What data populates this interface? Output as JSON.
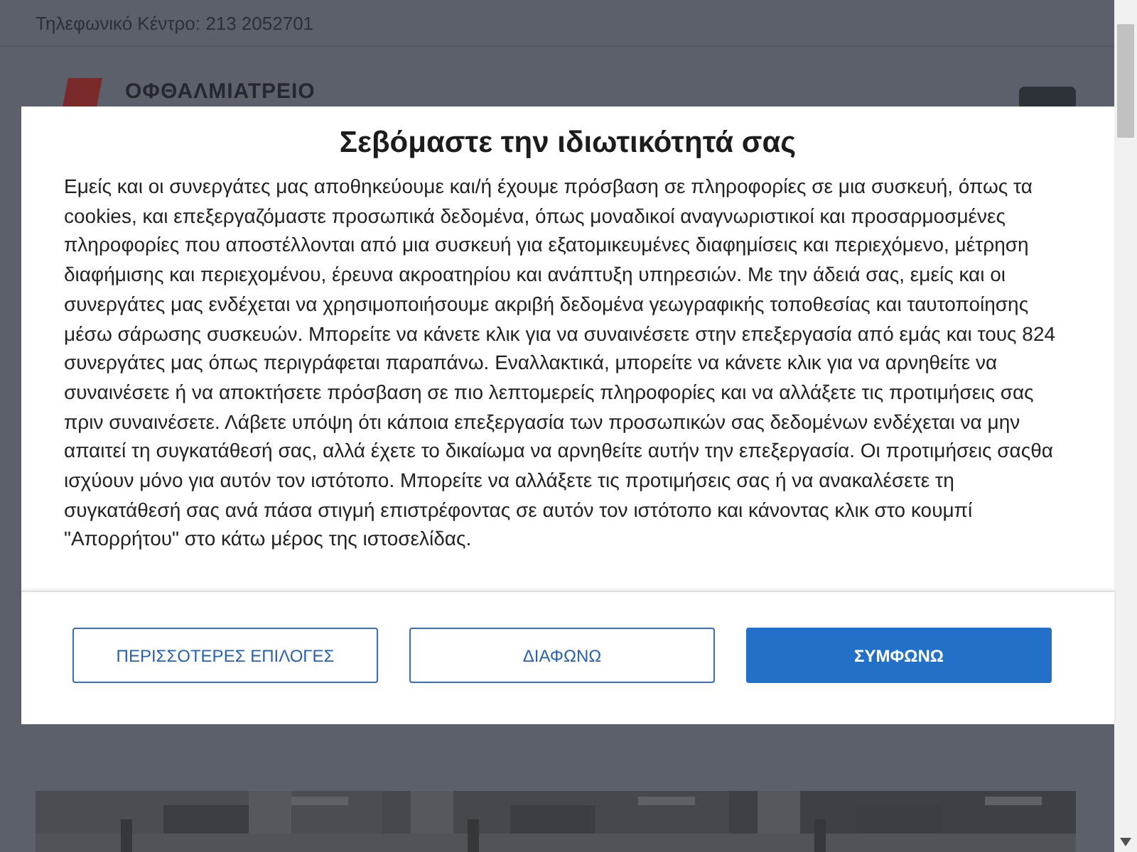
{
  "top_bar": {
    "phone": "Τηλεφωνικό Κέντρο: 213 2052701"
  },
  "header": {
    "logo_text": "ΟΦΘΑΛΜΙΑΤΡΕΙΟ"
  },
  "consent_dialog": {
    "title": "Σεβόμαστε την ιδιωτικότητά σας",
    "body": "Εμείς και οι συνεργάτες μας αποθηκεύουμε και/ή έχουμε πρόσβαση σε πληροφορίες σε μια συσκευή, όπως τα cookies, και επεξεργαζόμαστε προσωπικά δεδομένα, όπως μοναδικοί αναγνωριστικοί και προσαρμοσμένες πληροφορίες που αποστέλλονται από μια συσκευή για εξατομικευμένες διαφημίσεις και περιεχόμενο, μέτρηση διαφήμισης και περιεχομένου, έρευνα ακροατηρίου και ανάπτυξη υπηρεσιών. Με την άδειά σας, εμείς και οι συνεργάτες μας ενδέχεται να χρησιμοποιήσουμε ακριβή δεδομένα γεωγραφικής τοποθεσίας και ταυτοποίησης μέσω σάρωσης συσκευών. Μπορείτε να κάνετε κλικ για να συναινέσετε στην επεξεργασία από εμάς και τους 824 συνεργάτες μας όπως περιγράφεται παραπάνω. Εναλλακτικά, μπορείτε να κάνετε κλικ για να αρνηθείτε να συναινέσετε ή να αποκτήσετε πρόσβαση σε πιο λεπτομερείς πληροφορίες και να αλλάξετε τις προτιμήσεις σας πριν συναινέσετε. Λάβετε υπόψη ότι κάποια επεξεργασία των προσωπικών σας δεδομένων ενδέχεται να μην απαιτεί τη συγκατάθεσή σας, αλλά έχετε το δικαίωμα να αρνηθείτε αυτήν την επεξεργασία. Οι προτιμήσεις σαςθα ισχύουν μόνο για αυτόν τον ιστότοπο. Μπορείτε να αλλάξετε τις προτιμήσεις σας ή να ανακαλέσετε τη συγκατάθεσή σας ανά πάσα στιγμή επιστρέφοντας σε αυτόν τον ιστότοπο και κάνοντας κλικ στο κουμπί \"Απορρήτου\" στο κάτω μέρος της ιστοσελίδας.",
    "buttons": [
      {
        "label": "ΠΕΡΙΣΣΟΤΕΡΕΣ ΕΠΙΛΟΓΕΣ",
        "kind": "outline"
      },
      {
        "label": "ΔΙΑΦΩΝΩ",
        "kind": "outline"
      },
      {
        "label": "ΣΥΜΦΩΝΩ",
        "kind": "primary"
      }
    ]
  }
}
